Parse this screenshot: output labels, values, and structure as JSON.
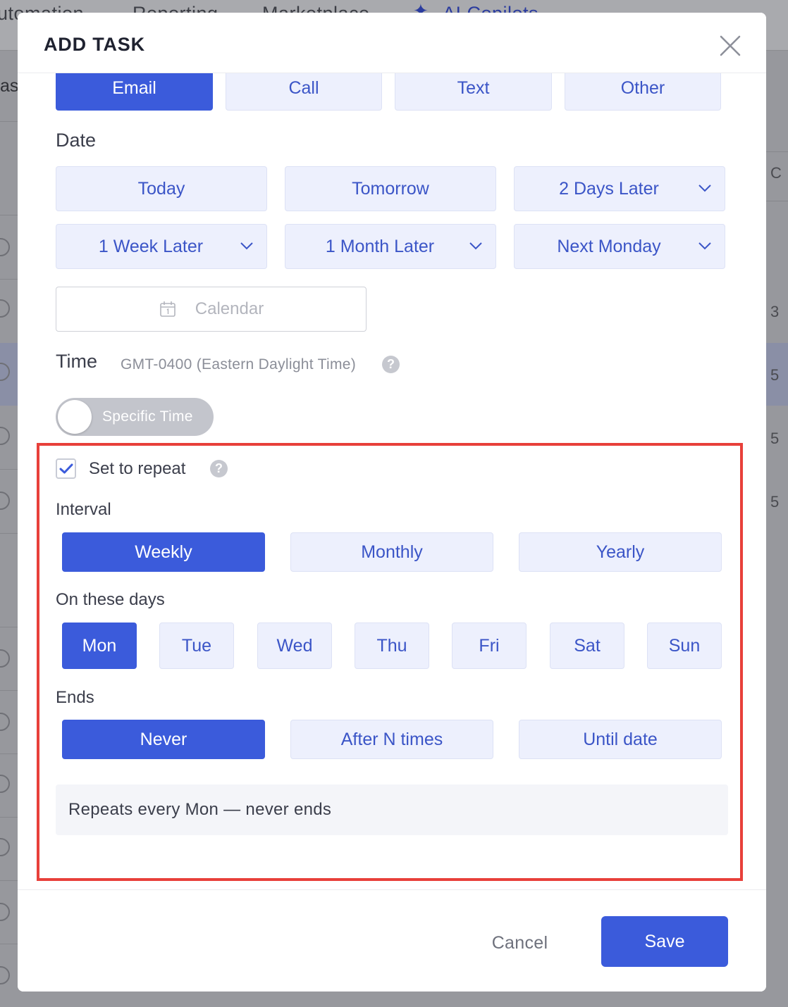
{
  "background": {
    "nav_items": [
      "utomation",
      "Reporting",
      "Marketplace",
      "AI Copilots"
    ],
    "left_partial": "ask",
    "right_partial": [
      "C",
      "3",
      "5",
      "5",
      "5"
    ]
  },
  "modal": {
    "title": "ADD TASK",
    "task_types": [
      {
        "label": "Email",
        "active": true
      },
      {
        "label": "Call",
        "active": false
      },
      {
        "label": "Text",
        "active": false
      },
      {
        "label": "Other",
        "active": false
      }
    ],
    "date": {
      "label": "Date",
      "options": [
        {
          "label": "Today",
          "dropdown": false
        },
        {
          "label": "Tomorrow",
          "dropdown": false
        },
        {
          "label": "2 Days Later",
          "dropdown": true
        },
        {
          "label": "1 Week Later",
          "dropdown": true
        },
        {
          "label": "1 Month Later",
          "dropdown": true
        },
        {
          "label": "Next Monday",
          "dropdown": true
        }
      ],
      "calendar_placeholder": "Calendar"
    },
    "time": {
      "label": "Time",
      "timezone": "GMT-0400 (Eastern Daylight Time)",
      "toggle_label": "Specific Time",
      "toggle_on": false
    },
    "repeat": {
      "checkbox_label": "Set to repeat",
      "checked": true,
      "interval_label": "Interval",
      "intervals": [
        {
          "label": "Weekly",
          "active": true
        },
        {
          "label": "Monthly",
          "active": false
        },
        {
          "label": "Yearly",
          "active": false
        }
      ],
      "days_label": "On these days",
      "days": [
        {
          "label": "Mon",
          "active": true
        },
        {
          "label": "Tue",
          "active": false
        },
        {
          "label": "Wed",
          "active": false
        },
        {
          "label": "Thu",
          "active": false
        },
        {
          "label": "Fri",
          "active": false
        },
        {
          "label": "Sat",
          "active": false
        },
        {
          "label": "Sun",
          "active": false
        }
      ],
      "ends_label": "Ends",
      "ends": [
        {
          "label": "Never",
          "active": true
        },
        {
          "label": "After N times",
          "active": false
        },
        {
          "label": "Until date",
          "active": false
        }
      ],
      "summary": "Repeats every Mon — never ends"
    },
    "footer": {
      "cancel_label": "Cancel",
      "save_label": "Save"
    }
  },
  "colors": {
    "primary": "#3b5bdb",
    "chip_bg": "#edf0fd",
    "chip_text": "#3b55c7",
    "highlight_border": "#e8403a"
  }
}
